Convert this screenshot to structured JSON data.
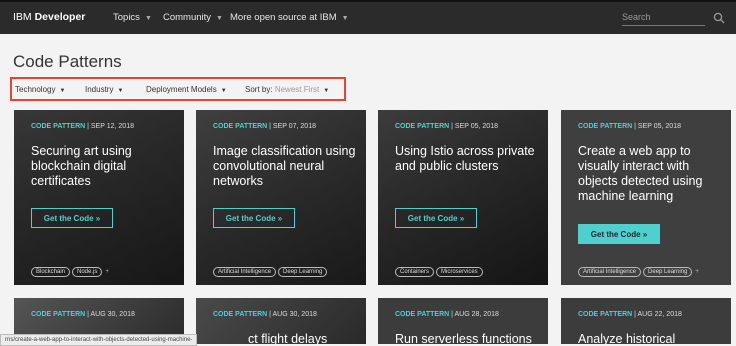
{
  "header": {
    "brand_prefix": "IBM",
    "brand_bold": "Developer",
    "nav": [
      {
        "label": "Topics"
      },
      {
        "label": "Community"
      },
      {
        "label": "More open source at IBM"
      }
    ],
    "search_placeholder": "Search"
  },
  "page_title": "Code Patterns",
  "filters": [
    {
      "label": "Technology"
    },
    {
      "label": "Industry"
    },
    {
      "label": "Deployment Models"
    }
  ],
  "sort": {
    "label": "Sort by:",
    "value": "Newest First"
  },
  "cards": [
    {
      "kind": "CODE PATTERN",
      "date": "SEP 12, 2018",
      "title": "Securing art using blockchain digital certificates",
      "button": "Get the Code »",
      "tags": [
        "Blockchain",
        "Node.js"
      ],
      "more": "+"
    },
    {
      "kind": "CODE PATTERN",
      "date": "SEP 07, 2018",
      "title": "Image classification using convolutional neural networks",
      "button": "Get the Code »",
      "tags": [
        "Artificial Intelligence",
        "Deep Learning"
      ],
      "more": ""
    },
    {
      "kind": "CODE PATTERN",
      "date": "SEP 05, 2018",
      "title": "Using Istio across private and public clusters",
      "button": "Get the Code »",
      "tags": [
        "Containers",
        "Microservices"
      ],
      "more": ""
    },
    {
      "kind": "CODE PATTERN",
      "date": "SEP 05, 2018",
      "title": "Create a web app to visually interact with objects detected using machine learning",
      "button": "Get the Code »",
      "tags": [
        "Artificial Intelligence",
        "Deep Learning"
      ],
      "more": "+"
    },
    {
      "kind": "CODE PATTERN",
      "date": "AUG 30, 2018",
      "title": "",
      "button": "",
      "tags": [],
      "more": ""
    },
    {
      "kind": "CODE PATTERN",
      "date": "AUG 30, 2018",
      "title": "ct flight delays",
      "button": "",
      "tags": [],
      "more": ""
    },
    {
      "kind": "CODE PATTERN",
      "date": "AUG 28, 2018",
      "title": "Run serverless functions",
      "button": "",
      "tags": [],
      "more": ""
    },
    {
      "kind": "CODE PATTERN",
      "date": "AUG 22, 2018",
      "title": "Analyze historical",
      "button": "",
      "tags": [],
      "more": ""
    }
  ],
  "status_url": "rns/create-a-web-app-to-interact-with-objects-detected-using-machine-"
}
